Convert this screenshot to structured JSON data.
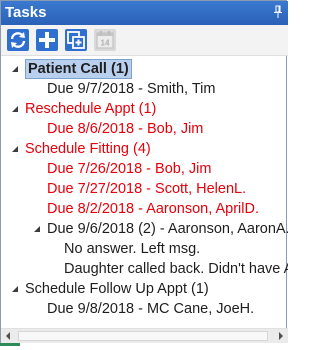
{
  "window": {
    "title": "Tasks"
  },
  "toolbar": {
    "buttons": [
      {
        "name": "refresh",
        "icon": "refresh-icon",
        "enabled": true
      },
      {
        "name": "add",
        "icon": "plus-icon",
        "enabled": true
      },
      {
        "name": "copy",
        "icon": "copy-icon",
        "enabled": true
      },
      {
        "name": "calendar",
        "icon": "calendar-icon",
        "label": "14",
        "enabled": false
      }
    ]
  },
  "tree": {
    "groups": [
      {
        "label": "Patient Call (1)",
        "color": "#1e1e1e",
        "selected": true,
        "items": [
          {
            "label": "Due 9/7/2018 - Smith, Tim",
            "color": "#1e1e1e"
          }
        ]
      },
      {
        "label": "Reschedule Appt (1)",
        "color": "#e8000b",
        "items": [
          {
            "label": "Due 8/6/2018 - Bob, Jim",
            "color": "#e8000b"
          }
        ]
      },
      {
        "label": "Schedule Fitting (4)",
        "color": "#e8000b",
        "items": [
          {
            "label": "Due 7/26/2018 - Bob, Jim",
            "color": "#e8000b"
          },
          {
            "label": "Due 7/27/2018 - Scott, HelenL.",
            "color": "#e8000b"
          },
          {
            "label": "Due 8/2/2018 - Aaronson, AprilD.",
            "color": "#e8000b"
          },
          {
            "label": "Due 9/6/2018 (2) - Aaronson, AaronA.",
            "color": "#1e1e1e",
            "notes": [
              "No answer. Left msg.",
              "Daughter called back. Didn't have A"
            ]
          }
        ]
      },
      {
        "label": "Schedule Follow Up Appt (1)",
        "color": "#1e1e1e",
        "items": [
          {
            "label": "Due 9/8/2018 - MC Cane, JoeH.",
            "color": "#1e1e1e"
          }
        ]
      }
    ]
  }
}
